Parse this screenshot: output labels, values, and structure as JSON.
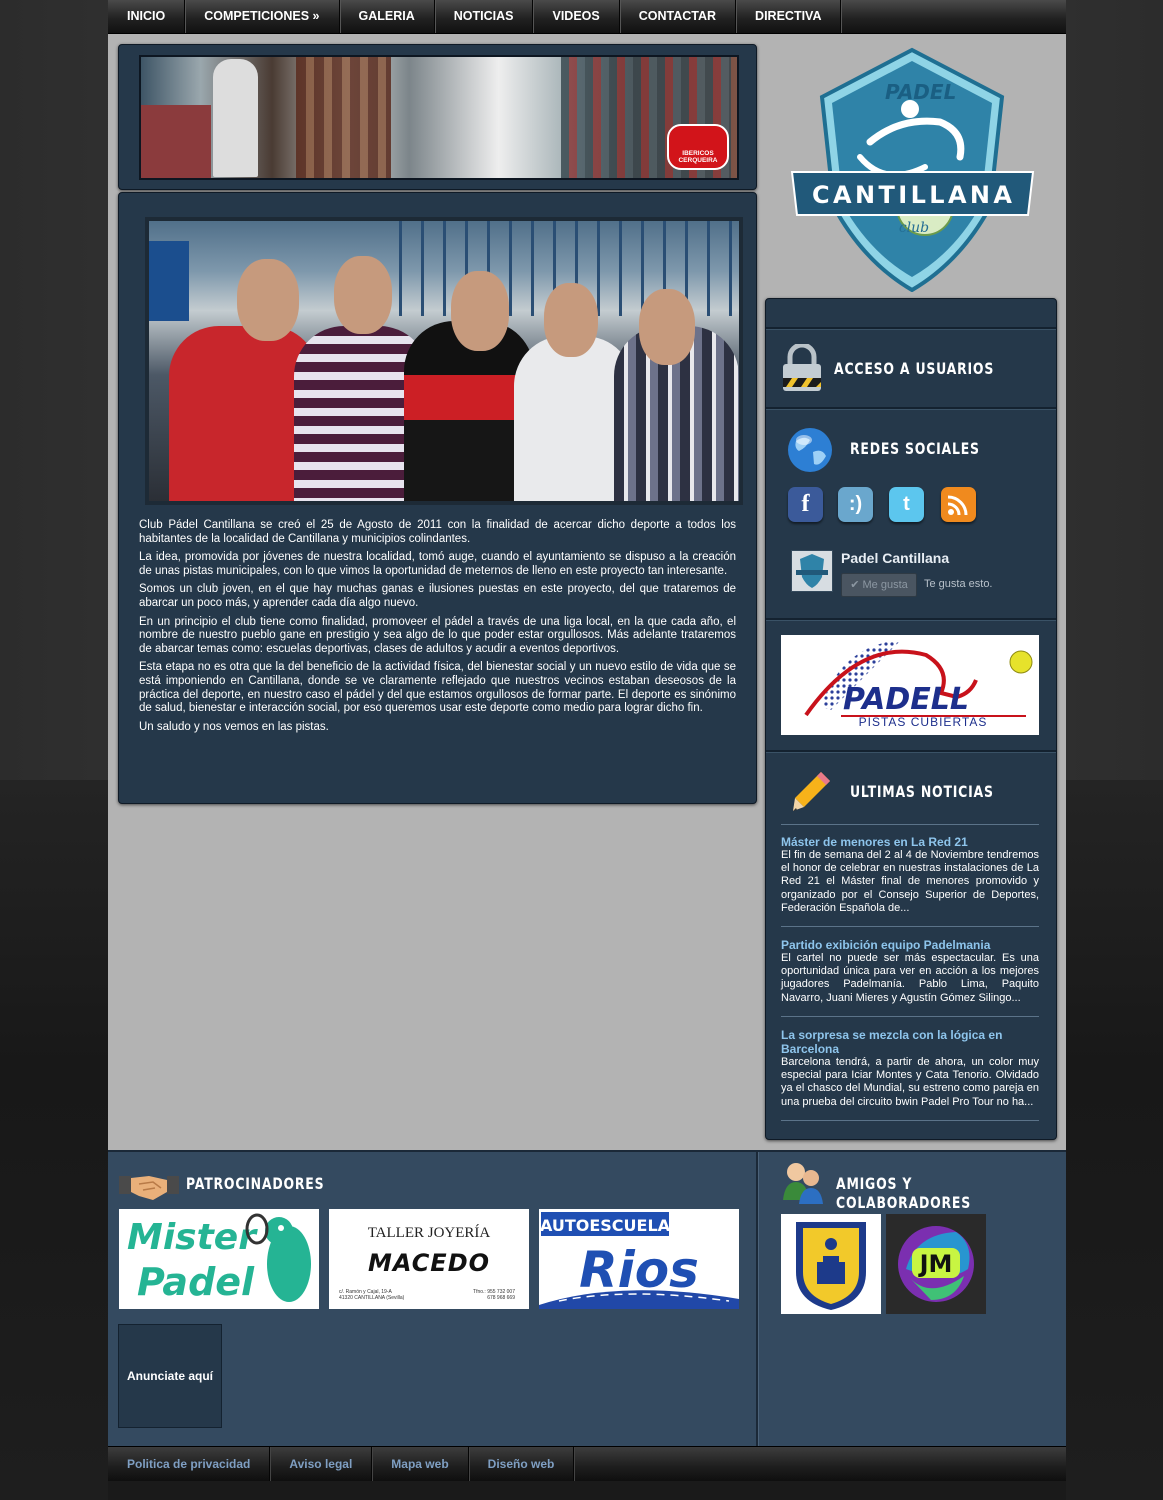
{
  "nav": {
    "items": [
      "INICIO",
      "COMPETICIONES »",
      "GALERIA",
      "NOTICIAS",
      "VIDEOS",
      "CONTACTAR",
      "DIRECTIVA"
    ]
  },
  "banner": {
    "sponsor_logo_text": "IBERICOS CERQUEIRA"
  },
  "article": {
    "paragraphs": [
      "Club Pádel Cantillana se creó el 25 de Agosto de 2011 con la finalidad de acercar dicho deporte a todos los habitantes de la localidad de Cantillana y municipios colindantes.",
      "La idea, promovida por jóvenes de nuestra localidad, tomó auge, cuando el ayuntamiento se dispuso a la creación de unas pistas municipales, con lo que vimos la oportunidad de meternos de lleno en este proyecto tan interesante.",
      "Somos un club joven, en el que hay muchas ganas e ilusiones puestas en este proyecto, del que trataremos de abarcar un poco más, y aprender cada día algo nuevo.",
      "En un principio el club tiene como finalidad, promoveer el pádel a través de una liga local, en la que cada año, el nombre de nuestro pueblo gane en prestigio y sea algo de lo que poder estar orgullosos. Más adelante trataremos de abarcar temas como: escuelas deportivas, clases de adultos y acudir a eventos deportivos.",
      "Esta etapa no es otra que la del beneficio de la actividad física, del bienestar social y un nuevo estilo de vida que se está imponiendo en Cantillana, donde se ve claramente reflejado que nuestros vecinos estaban deseosos de la práctica del deporte, en nuestro caso el pádel y del que estamos orgullosos de formar parte. El deporte es sinónimo de salud, bienestar e interacción social, por eso queremos usar este deporte como medio para lograr dicho fin.",
      "Un saludo y nos vemos en las pistas."
    ]
  },
  "club_logo": {
    "top": "PADEL",
    "middle": "CANTILLANA",
    "bottom": "club"
  },
  "sidebar": {
    "login_title": "ACCESO A USUARIOS",
    "social_title": "REDES SOCIALES",
    "social_icons": [
      "facebook-icon",
      "tuenti-icon",
      "twitter-icon",
      "rss-icon"
    ],
    "facebook": {
      "page_name": "Padel Cantillana",
      "like_button": "Me gusta",
      "like_text": "Te gusta esto."
    },
    "ad": {
      "brand": "PADELL",
      "subtitle": "PISTAS CUBIERTAS"
    },
    "news_title": "ULTIMAS NOTICIAS",
    "news": [
      {
        "title": "Máster de menores en La Red 21",
        "text": "El fin de semana del 2 al 4 de Noviembre tendremos el honor de celebrar en nuestras instalaciones de La Red 21 el Máster final de menores promovido y organizado por el Consejo Superior de Deportes, Federación Española de..."
      },
      {
        "title": "Partido exibición equipo Padelmania",
        "text": " El cartel no puede ser más espectacular. Es una oportunidad única para ver en acción a los mejores jugadores Padelmanía. Pablo Lima, Paquito Navarro, Juani Mieres y Agustín Gómez Silingo..."
      },
      {
        "title": "La sorpresa se mezcla con la lógica en Barcelona",
        "text": " Barcelona tendrá, a partir de ahora, un color muy especial para Iciar Montes y Cata Tenorio. Olvidado ya el chasco del Mundial, su estreno como pareja en una prueba del circuito bwin Padel Pro Tour no ha..."
      }
    ]
  },
  "sponsors": {
    "title": "PATROCINADORES",
    "mister_padel": [
      "Mister",
      "Padel"
    ],
    "macedo": {
      "line1": "TALLER JOYERÍA",
      "line2": "MACEDO",
      "address": "c/. Ramón y Cajal, 19-A\n41320 CANTILLANA (Sevilla)",
      "phones": "Tfno.: 955 732 007\n678 968 669"
    },
    "autoescuela": {
      "line1": "AUTOESCUELA",
      "line2": "Rios"
    },
    "ad_here": "Anunciate aquí"
  },
  "friends": {
    "title": "AMIGOS Y COLABORADORES",
    "jm_logo": "JM"
  },
  "footer": {
    "items": [
      "Politica de privacidad",
      "Aviso legal",
      "Mapa web",
      "Diseño web"
    ]
  },
  "colors": {
    "panel": "#25384a",
    "bottom_panel": "#344a60",
    "link_blue": "#8ec5ec",
    "page_grey": "#b3b3b3"
  }
}
